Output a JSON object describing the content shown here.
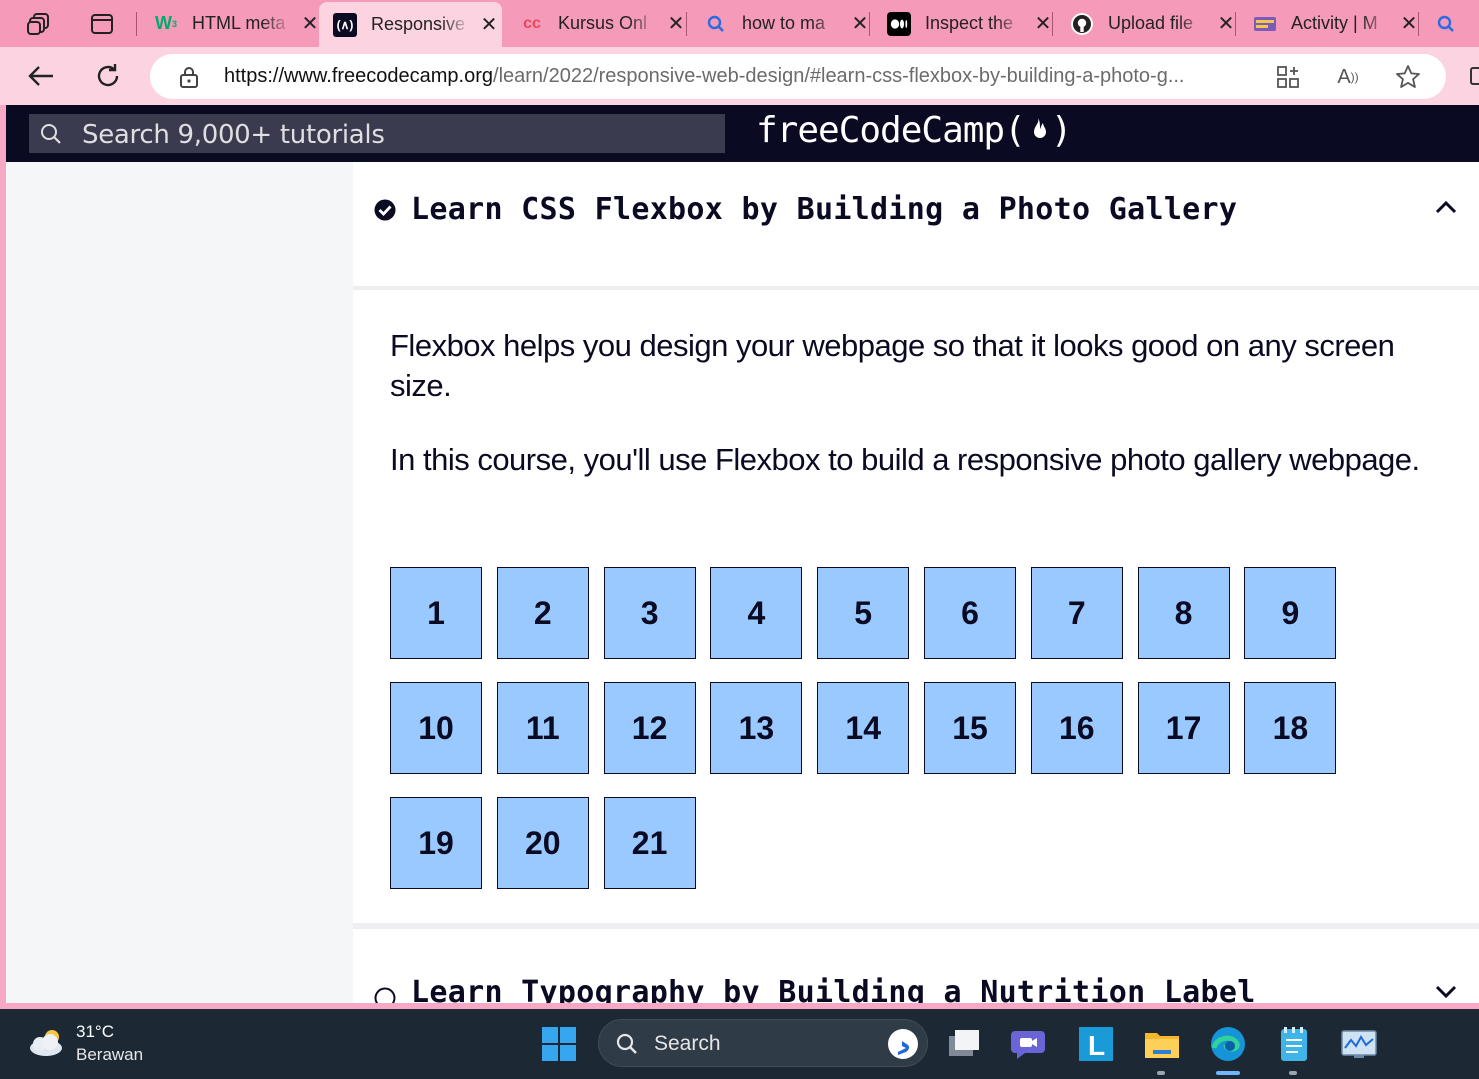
{
  "browser": {
    "tabs": [
      {
        "title": "HTML meta",
        "favicon": "w3-icon"
      },
      {
        "title": "Responsive",
        "favicon": "freecodecamp-icon"
      },
      {
        "title": "Kursus Onl",
        "favicon": "codepolitan-icon"
      },
      {
        "title": "how to ma",
        "favicon": "search-icon"
      },
      {
        "title": "Inspect the",
        "favicon": "medium-icon"
      },
      {
        "title": "Upload file",
        "favicon": "github-icon"
      },
      {
        "title": "Activity | M",
        "favicon": "activity-icon"
      }
    ],
    "active_tab_index": 1,
    "url_domain": "https://www.freecodecamp.org",
    "url_path": "/learn/2022/responsive-web-design/#learn-css-flexbox-by-building-a-photo-g..."
  },
  "fcc": {
    "search_placeholder": "Search 9,000+ tutorials",
    "logo_left": "freeCodeCamp(",
    "logo_right": ")"
  },
  "block": {
    "title": "Learn CSS Flexbox by Building a Photo Gallery",
    "completed": true,
    "expanded": true,
    "intro_1": "Flexbox helps you design your webpage so that it looks good on any screen size.",
    "intro_2": "In this course, you'll use Flexbox to build a responsive photo gallery webpage.",
    "steps": [
      "1",
      "2",
      "3",
      "4",
      "5",
      "6",
      "7",
      "8",
      "9",
      "10",
      "11",
      "12",
      "13",
      "14",
      "15",
      "16",
      "17",
      "18",
      "19",
      "20",
      "21"
    ]
  },
  "next_block": {
    "title": "Learn Typography by Building a Nutrition Label",
    "completed": false,
    "expanded": false
  },
  "taskbar": {
    "temperature": "31°C",
    "weather": "Berawan",
    "search_label": "Search"
  },
  "colors": {
    "tab_bar": "#f59ab9",
    "fcc_nav": "#0a0a23",
    "step_cell": "#99c9ff"
  }
}
